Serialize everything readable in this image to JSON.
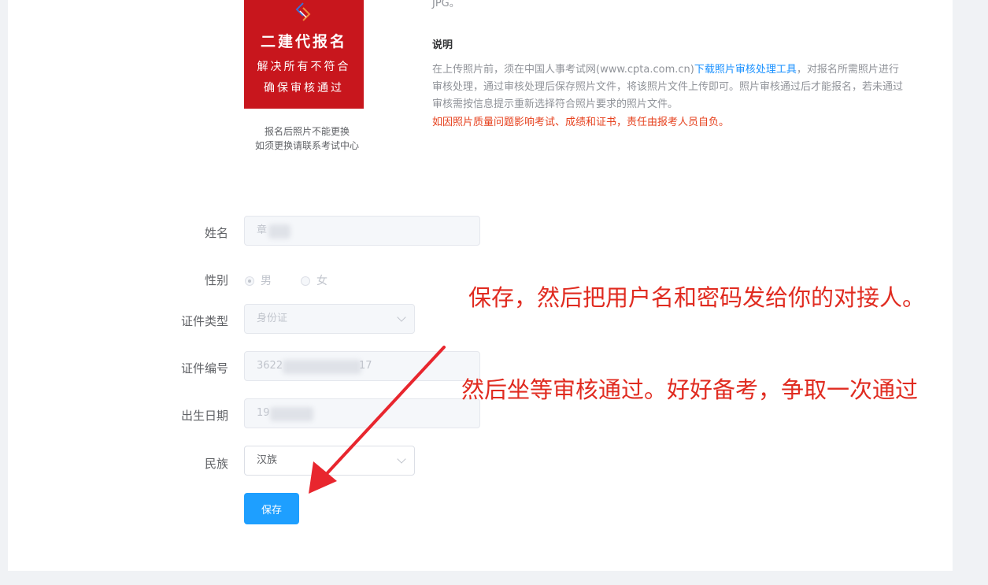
{
  "photo": {
    "line1": "二建代报名",
    "line2": "解决所有不符合",
    "line3": "确保审核通过",
    "note_line1": "报名后照片不能更换",
    "note_line2": "如须更换请联系考试中心"
  },
  "explain": {
    "jpg_fragment": "JPG。",
    "title": "说明",
    "text_before_link": "在上传照片前，须在中国人事考试网(www.cpta.com.cn)",
    "link": "下载照片审核处理工具",
    "text_after_link": "，对报名所需照片进行审核处理，通过审核处理后保存照片文件，将该照片文件上传即可。照片审核通过后才能报名，若未通过审核需按信息提示重新选择符合照片要求的照片文件。",
    "warning": "如因照片质量问题影响考试、成绩和证书，责任由报考人员自负。"
  },
  "form": {
    "name_label": "姓名",
    "name_value": "章",
    "gender_label": "性别",
    "gender_male": "男",
    "gender_female": "女",
    "idtype_label": "证件类型",
    "idtype_value": "身份证",
    "idno_label": "证件编号",
    "idno_prefix": "3622",
    "idno_suffix": "17",
    "birth_label": "出生日期",
    "birth_value": "19",
    "ethnic_label": "民族",
    "ethnic_value": "汉族",
    "save_label": "保存"
  },
  "annotations": {
    "line1": "保存，然后把用户名和密码发给你的对接人。",
    "line2": "然后坐等审核通过。好好备考，争取一次通过"
  },
  "colors": {
    "annotation": "#e02b20",
    "primary_button": "#1e9fff",
    "photo_bg": "#c8161d",
    "link": "#1890ff",
    "warning": "#e6411e"
  }
}
